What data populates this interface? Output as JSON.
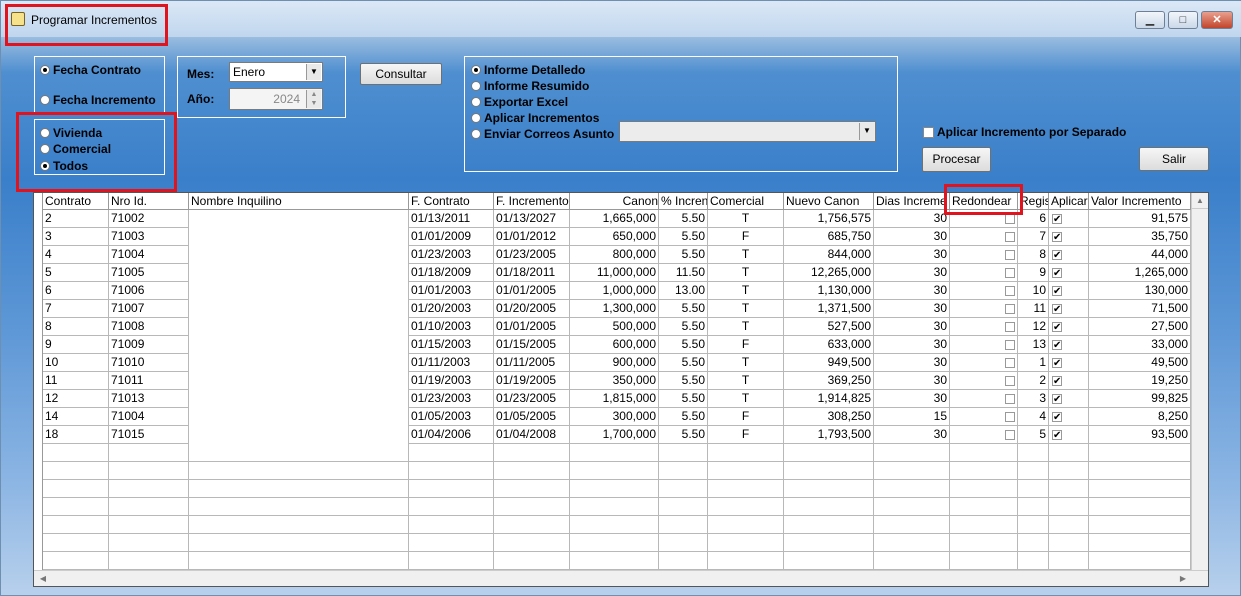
{
  "window": {
    "title": "Programar Incrementos",
    "min": "▁",
    "max": "□",
    "close": "✕"
  },
  "fecha_group": {
    "options": [
      {
        "label": "Fecha Contrato",
        "checked": true
      },
      {
        "label": "Fecha Incremento",
        "checked": false
      }
    ]
  },
  "tipo_group": {
    "options": [
      {
        "label": "Vivienda",
        "checked": false
      },
      {
        "label": "Comercial",
        "checked": false
      },
      {
        "label": "Todos",
        "checked": true
      }
    ]
  },
  "periodo": {
    "mes_label": "Mes:",
    "mes_value": "Enero",
    "anio_label": "Año:",
    "anio_value": "2024"
  },
  "consultar_label": "Consultar",
  "informe_group": {
    "options": [
      {
        "label": "Informe Detalledo",
        "checked": true
      },
      {
        "label": "Informe Resumido",
        "checked": false
      },
      {
        "label": "Exportar Excel",
        "checked": false
      },
      {
        "label": "Aplicar Incrementos",
        "checked": false
      },
      {
        "label": "Enviar Correos Asunto",
        "checked": false
      }
    ]
  },
  "separado_label": "Aplicar Incremento por Separado",
  "procesar_label": "Procesar",
  "salir_label": "Salir",
  "grid": {
    "headers": [
      "Contrato",
      "Nro Id.",
      "Nombre Inquilino",
      "F. Contrato",
      "F. Incremento",
      "Canon",
      "% Incren",
      "Comercial",
      "Nuevo Canon",
      "Dias Increme",
      "Redondear",
      "Regis",
      "Aplicar",
      "Valor Incremento"
    ],
    "rows": [
      [
        "2",
        "71002",
        "",
        "01/13/2011",
        "01/13/2027",
        "1,665,000",
        "5.50",
        "T",
        "1,756,575",
        "30",
        "",
        "6",
        "",
        "91,575"
      ],
      [
        "3",
        "71003",
        "",
        "01/01/2009",
        "01/01/2012",
        "650,000",
        "5.50",
        "F",
        "685,750",
        "30",
        "",
        "7",
        "",
        "35,750"
      ],
      [
        "4",
        "71004",
        "",
        "01/23/2003",
        "01/23/2005",
        "800,000",
        "5.50",
        "T",
        "844,000",
        "30",
        "",
        "8",
        "",
        "44,000"
      ],
      [
        "5",
        "71005",
        "",
        "01/18/2009",
        "01/18/2011",
        "11,000,000",
        "11.50",
        "T",
        "12,265,000",
        "30",
        "",
        "9",
        "",
        "1,265,000"
      ],
      [
        "6",
        "71006",
        "",
        "01/01/2003",
        "01/01/2005",
        "1,000,000",
        "13.00",
        "T",
        "1,130,000",
        "30",
        "",
        "10",
        "",
        "130,000"
      ],
      [
        "7",
        "71007",
        "",
        "01/20/2003",
        "01/20/2005",
        "1,300,000",
        "5.50",
        "T",
        "1,371,500",
        "30",
        "",
        "11",
        "",
        "71,500"
      ],
      [
        "8",
        "71008",
        "",
        "01/10/2003",
        "01/01/2005",
        "500,000",
        "5.50",
        "T",
        "527,500",
        "30",
        "",
        "12",
        "",
        "27,500"
      ],
      [
        "9",
        "71009",
        "",
        "01/15/2003",
        "01/15/2005",
        "600,000",
        "5.50",
        "F",
        "633,000",
        "30",
        "",
        "13",
        "",
        "33,000"
      ],
      [
        "10",
        "71010",
        "",
        "01/11/2003",
        "01/11/2005",
        "900,000",
        "5.50",
        "T",
        "949,500",
        "30",
        "",
        "1",
        "",
        "49,500"
      ],
      [
        "11",
        "71011",
        "",
        "01/19/2003",
        "01/19/2005",
        "350,000",
        "5.50",
        "T",
        "369,250",
        "30",
        "",
        "2",
        "",
        "19,250"
      ],
      [
        "12",
        "71013",
        "",
        "01/23/2003",
        "01/23/2005",
        "1,815,000",
        "5.50",
        "T",
        "1,914,825",
        "30",
        "",
        "3",
        "",
        "99,825"
      ],
      [
        "14",
        "71004",
        "",
        "01/05/2003",
        "01/05/2005",
        "300,000",
        "5.50",
        "F",
        "308,250",
        "15",
        "",
        "4",
        "",
        "8,250"
      ],
      [
        "18",
        "71015",
        "",
        "01/04/2006",
        "01/04/2008",
        "1,700,000",
        "5.50",
        "F",
        "1,793,500",
        "30",
        "",
        "5",
        "",
        "93,500"
      ]
    ],
    "aplicar_checked": true,
    "redondear_checked": false
  },
  "colors": {
    "highlight": "#e0141e",
    "background": "#3a7fca"
  }
}
